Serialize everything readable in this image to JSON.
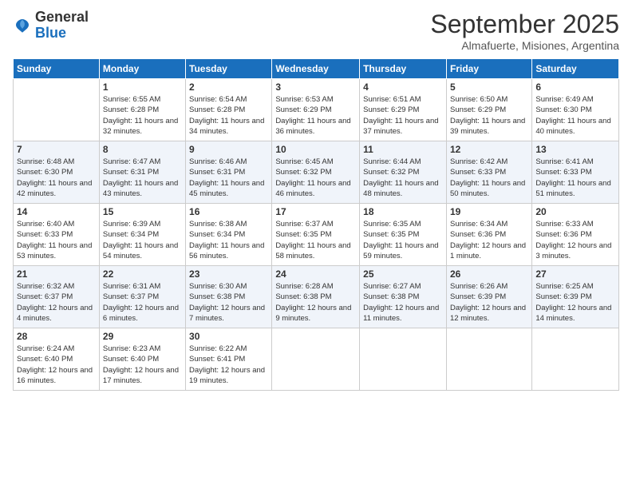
{
  "logo": {
    "general": "General",
    "blue": "Blue"
  },
  "header": {
    "month": "September 2025",
    "location": "Almafuerte, Misiones, Argentina"
  },
  "days_of_week": [
    "Sunday",
    "Monday",
    "Tuesday",
    "Wednesday",
    "Thursday",
    "Friday",
    "Saturday"
  ],
  "weeks": [
    [
      {
        "day": "",
        "info": ""
      },
      {
        "day": "1",
        "info": "Sunrise: 6:55 AM\nSunset: 6:28 PM\nDaylight: 11 hours\nand 32 minutes."
      },
      {
        "day": "2",
        "info": "Sunrise: 6:54 AM\nSunset: 6:28 PM\nDaylight: 11 hours\nand 34 minutes."
      },
      {
        "day": "3",
        "info": "Sunrise: 6:53 AM\nSunset: 6:29 PM\nDaylight: 11 hours\nand 36 minutes."
      },
      {
        "day": "4",
        "info": "Sunrise: 6:51 AM\nSunset: 6:29 PM\nDaylight: 11 hours\nand 37 minutes."
      },
      {
        "day": "5",
        "info": "Sunrise: 6:50 AM\nSunset: 6:29 PM\nDaylight: 11 hours\nand 39 minutes."
      },
      {
        "day": "6",
        "info": "Sunrise: 6:49 AM\nSunset: 6:30 PM\nDaylight: 11 hours\nand 40 minutes."
      }
    ],
    [
      {
        "day": "7",
        "info": "Sunrise: 6:48 AM\nSunset: 6:30 PM\nDaylight: 11 hours\nand 42 minutes."
      },
      {
        "day": "8",
        "info": "Sunrise: 6:47 AM\nSunset: 6:31 PM\nDaylight: 11 hours\nand 43 minutes."
      },
      {
        "day": "9",
        "info": "Sunrise: 6:46 AM\nSunset: 6:31 PM\nDaylight: 11 hours\nand 45 minutes."
      },
      {
        "day": "10",
        "info": "Sunrise: 6:45 AM\nSunset: 6:32 PM\nDaylight: 11 hours\nand 46 minutes."
      },
      {
        "day": "11",
        "info": "Sunrise: 6:44 AM\nSunset: 6:32 PM\nDaylight: 11 hours\nand 48 minutes."
      },
      {
        "day": "12",
        "info": "Sunrise: 6:42 AM\nSunset: 6:33 PM\nDaylight: 11 hours\nand 50 minutes."
      },
      {
        "day": "13",
        "info": "Sunrise: 6:41 AM\nSunset: 6:33 PM\nDaylight: 11 hours\nand 51 minutes."
      }
    ],
    [
      {
        "day": "14",
        "info": "Sunrise: 6:40 AM\nSunset: 6:33 PM\nDaylight: 11 hours\nand 53 minutes."
      },
      {
        "day": "15",
        "info": "Sunrise: 6:39 AM\nSunset: 6:34 PM\nDaylight: 11 hours\nand 54 minutes."
      },
      {
        "day": "16",
        "info": "Sunrise: 6:38 AM\nSunset: 6:34 PM\nDaylight: 11 hours\nand 56 minutes."
      },
      {
        "day": "17",
        "info": "Sunrise: 6:37 AM\nSunset: 6:35 PM\nDaylight: 11 hours\nand 58 minutes."
      },
      {
        "day": "18",
        "info": "Sunrise: 6:35 AM\nSunset: 6:35 PM\nDaylight: 11 hours\nand 59 minutes."
      },
      {
        "day": "19",
        "info": "Sunrise: 6:34 AM\nSunset: 6:36 PM\nDaylight: 12 hours\nand 1 minute."
      },
      {
        "day": "20",
        "info": "Sunrise: 6:33 AM\nSunset: 6:36 PM\nDaylight: 12 hours\nand 3 minutes."
      }
    ],
    [
      {
        "day": "21",
        "info": "Sunrise: 6:32 AM\nSunset: 6:37 PM\nDaylight: 12 hours\nand 4 minutes."
      },
      {
        "day": "22",
        "info": "Sunrise: 6:31 AM\nSunset: 6:37 PM\nDaylight: 12 hours\nand 6 minutes."
      },
      {
        "day": "23",
        "info": "Sunrise: 6:30 AM\nSunset: 6:38 PM\nDaylight: 12 hours\nand 7 minutes."
      },
      {
        "day": "24",
        "info": "Sunrise: 6:28 AM\nSunset: 6:38 PM\nDaylight: 12 hours\nand 9 minutes."
      },
      {
        "day": "25",
        "info": "Sunrise: 6:27 AM\nSunset: 6:38 PM\nDaylight: 12 hours\nand 11 minutes."
      },
      {
        "day": "26",
        "info": "Sunrise: 6:26 AM\nSunset: 6:39 PM\nDaylight: 12 hours\nand 12 minutes."
      },
      {
        "day": "27",
        "info": "Sunrise: 6:25 AM\nSunset: 6:39 PM\nDaylight: 12 hours\nand 14 minutes."
      }
    ],
    [
      {
        "day": "28",
        "info": "Sunrise: 6:24 AM\nSunset: 6:40 PM\nDaylight: 12 hours\nand 16 minutes."
      },
      {
        "day": "29",
        "info": "Sunrise: 6:23 AM\nSunset: 6:40 PM\nDaylight: 12 hours\nand 17 minutes."
      },
      {
        "day": "30",
        "info": "Sunrise: 6:22 AM\nSunset: 6:41 PM\nDaylight: 12 hours\nand 19 minutes."
      },
      {
        "day": "",
        "info": ""
      },
      {
        "day": "",
        "info": ""
      },
      {
        "day": "",
        "info": ""
      },
      {
        "day": "",
        "info": ""
      }
    ]
  ]
}
